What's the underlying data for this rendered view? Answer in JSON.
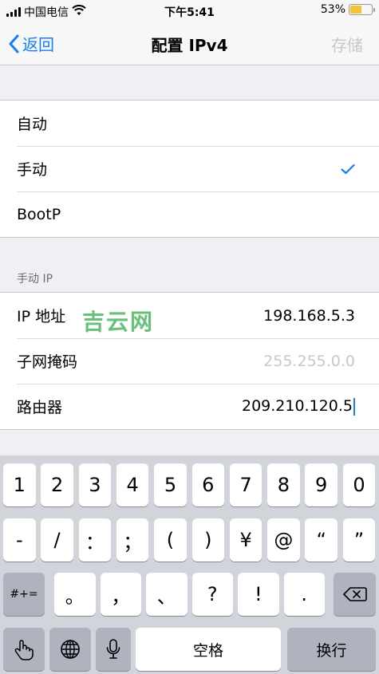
{
  "status_bar": {
    "carrier": "中国电信",
    "time": "下午5:41",
    "battery_percent": "53%",
    "battery_level": 0.53
  },
  "nav": {
    "back_label": "返回",
    "title": "配置 IPv4",
    "save_label": "存储"
  },
  "modes": [
    {
      "label": "自动",
      "checked": false
    },
    {
      "label": "手动",
      "checked": true
    },
    {
      "label": "BootP",
      "checked": false
    }
  ],
  "manual_section": {
    "header": "手动 IP",
    "fields": [
      {
        "label": "IP 地址",
        "value": "198.168.5.3"
      },
      {
        "label": "子网掩码",
        "placeholder": "255.255.0.0"
      },
      {
        "label": "路由器",
        "value": "209.210.120.5"
      }
    ]
  },
  "watermark": "吉云网",
  "keyboard": {
    "row1": [
      "1",
      "2",
      "3",
      "4",
      "5",
      "6",
      "7",
      "8",
      "9",
      "0"
    ],
    "row2": [
      "-",
      "/",
      "：",
      "；",
      "(",
      ")",
      "¥",
      "@",
      "“",
      "”"
    ],
    "row3_left": "#+=",
    "row3": [
      "。",
      "，",
      "、",
      "?",
      "!",
      "."
    ],
    "space_label": "空格",
    "return_label": "换行"
  },
  "colors": {
    "accent": "#157efb",
    "keyboard_bg": "#d1d4da"
  }
}
